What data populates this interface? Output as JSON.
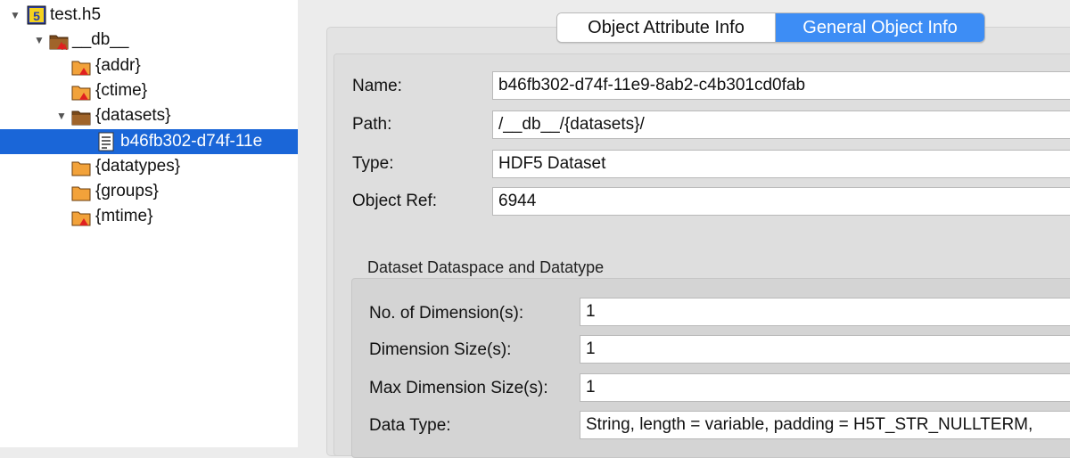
{
  "tree": {
    "root_label": "test.h5",
    "db_label": "__db__",
    "addr_label": "{addr}",
    "ctime_label": "{ctime}",
    "datasets_label": "{datasets}",
    "dataset_item_label": "b46fb302-d74f-11e",
    "datatypes_label": "{datatypes}",
    "groups_label": "{groups}",
    "mtime_label": "{mtime}"
  },
  "tabs": {
    "attribute": "Object Attribute Info",
    "general": "General Object Info"
  },
  "general": {
    "name_label": "Name:",
    "name_value": "b46fb302-d74f-11e9-8ab2-c4b301cd0fab",
    "path_label": "Path:",
    "path_value": "/__db__/{datasets}/",
    "type_label": "Type:",
    "type_value": "HDF5 Dataset",
    "objref_label": "Object Ref:",
    "objref_value": "6944"
  },
  "dataspace": {
    "title": "Dataset Dataspace and Datatype",
    "ndims_label": "No. of Dimension(s):",
    "ndims_value": "1",
    "dimsize_label": "Dimension Size(s):",
    "dimsize_value": "1",
    "maxdim_label": "Max Dimension Size(s):",
    "maxdim_value": "1",
    "dtype_label": "Data Type:",
    "dtype_value": "String, length = variable, padding = H5T_STR_NULLTERM,"
  },
  "colors": {
    "selection": "#1a66d8",
    "active_tab": "#3d8df5",
    "folder": "#f2a23a"
  },
  "icons": {
    "h5_file": "hdf5-file-icon",
    "group": "folder-icon",
    "group_with_attrs": "folder-attribute-icon",
    "dataset": "dataset-icon",
    "expanded": "triangle-down-icon"
  }
}
